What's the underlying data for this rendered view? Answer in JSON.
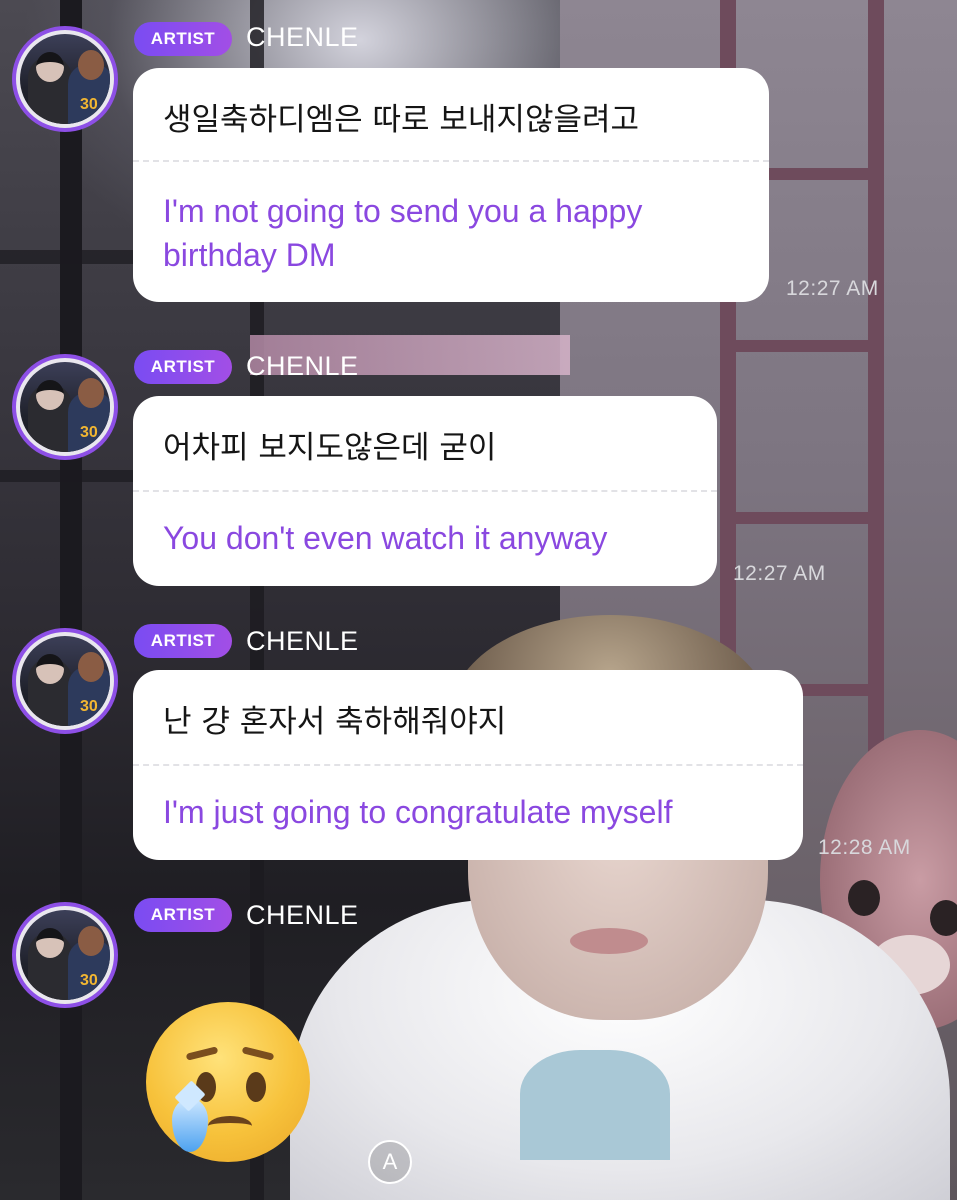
{
  "messages": [
    {
      "badge": "ARTIST",
      "sender": "CHENLE",
      "korean": "생일축하디엠은 따로 보내지않을려고",
      "english": "I'm not going to send you a happy birthday DM",
      "time": "12:27 AM"
    },
    {
      "badge": "ARTIST",
      "sender": "CHENLE",
      "korean": "어차피 보지도않은데 굳이",
      "english": "You don't even watch it anyway",
      "time": "12:27 AM"
    },
    {
      "badge": "ARTIST",
      "sender": "CHENLE",
      "korean": "난 걍 혼자서 축하해줘야지",
      "english": "I'm just going to congratulate myself",
      "time": "12:28 AM"
    },
    {
      "badge": "ARTIST",
      "sender": "CHENLE",
      "emoji": "crying-face-emoji"
    }
  ],
  "avatar": {
    "jersey_number": "30"
  },
  "controls": {
    "auto_translate_label": "A"
  },
  "colors": {
    "badge_gradient_start": "#7a4cf2",
    "badge_gradient_end": "#a24ee6",
    "translation_text": "#8a48e0",
    "avatar_ring": "#8d4fe6"
  }
}
